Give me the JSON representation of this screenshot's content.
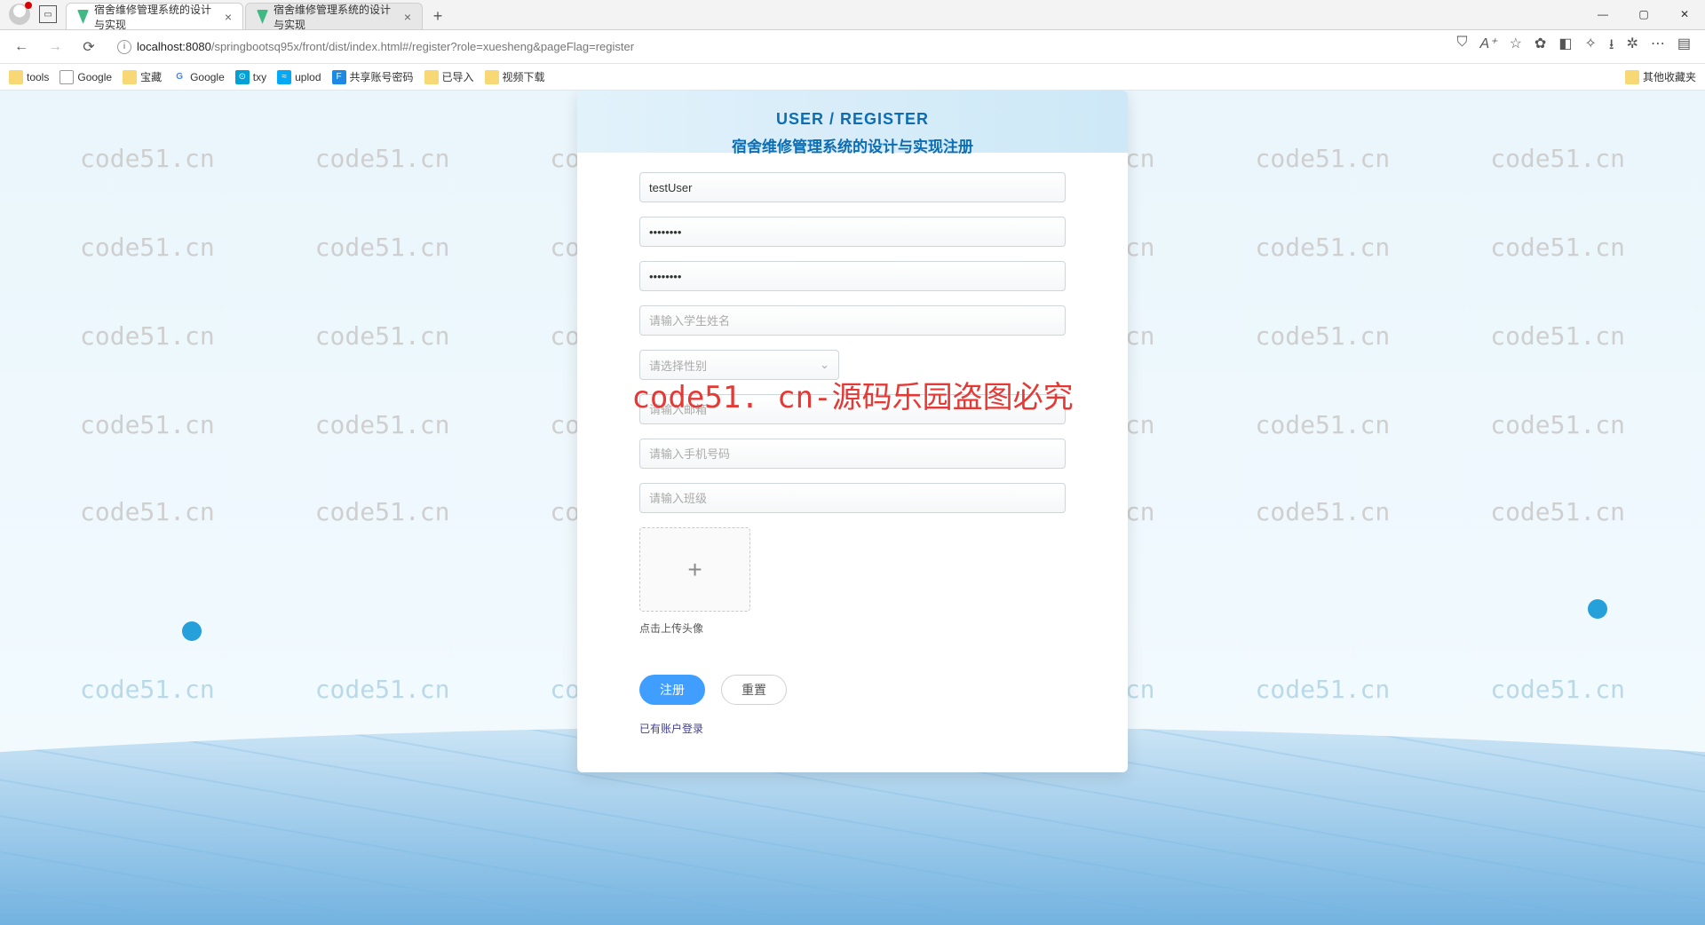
{
  "browser": {
    "tabs": [
      {
        "title": "宿舍维修管理系统的设计与实现",
        "active": true
      },
      {
        "title": "宿舍维修管理系统的设计与实现",
        "active": false
      }
    ],
    "url_host": "localhost:8080",
    "url_path": "/springbootsq95x/front/dist/index.html#/register?role=xuesheng&pageFlag=register"
  },
  "bookmarks": {
    "items": [
      "tools",
      "Google",
      "宝藏",
      "Google",
      "txy",
      "uplod",
      "共享账号密码",
      "已导入",
      "视频下载"
    ],
    "overflow": "其他收藏夹"
  },
  "watermark_text": "code51.cn",
  "overlay_red": "code51. cn-源码乐园盗图必究",
  "card": {
    "title_en": "USER / REGISTER",
    "title_cn": "宿舍维修管理系统的设计与实现注册",
    "username_value": "testUser",
    "password_value": "••••••••",
    "password2_value": "••••••••",
    "name_placeholder": "请输入学生姓名",
    "gender_placeholder": "请选择性别",
    "email_placeholder": "请输入邮箱",
    "phone_placeholder": "请输入手机号码",
    "class_placeholder": "请输入班级",
    "upload_hint": "点击上传头像",
    "submit": "注册",
    "reset": "重置",
    "login_link": "已有账户登录"
  }
}
